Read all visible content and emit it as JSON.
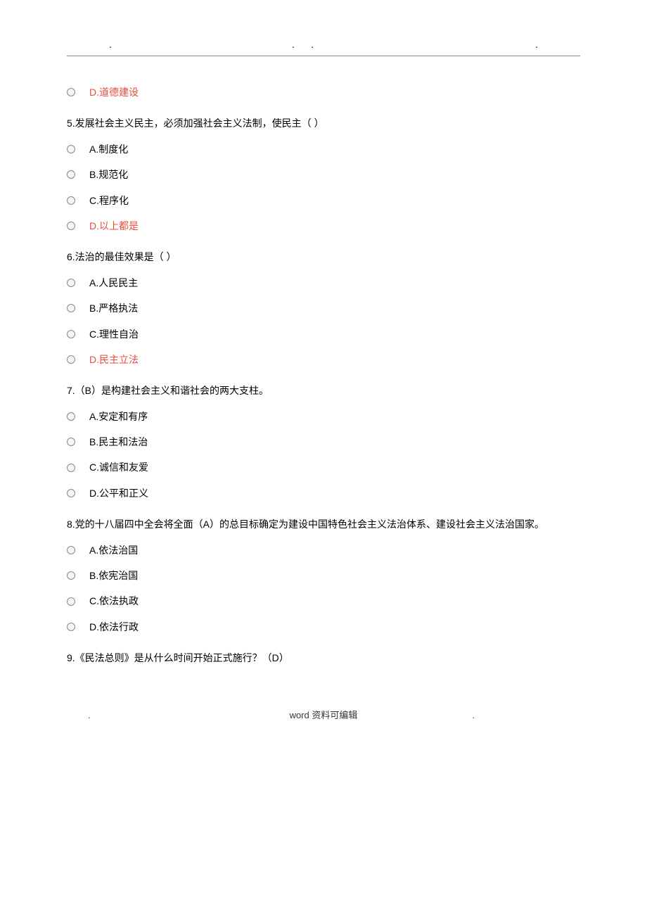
{
  "options_pre": [
    {
      "label": "D.道德建设",
      "highlighted": true
    }
  ],
  "questions": [
    {
      "text": "5.发展社会主义民主，必须加强社会主义法制，使民主（ ）",
      "options": [
        {
          "label": "A.制度化",
          "highlighted": false
        },
        {
          "label": "B.规范化",
          "highlighted": false
        },
        {
          "label": "C.程序化",
          "highlighted": false
        },
        {
          "label": "D.以上都是",
          "highlighted": true
        }
      ]
    },
    {
      "text": "6.法治的最佳效果是（ ）",
      "options": [
        {
          "label": "A.人民民主",
          "highlighted": false
        },
        {
          "label": "B.严格执法",
          "highlighted": false
        },
        {
          "label": "C.理性自治",
          "highlighted": false
        },
        {
          "label": "D.民主立法",
          "highlighted": true
        }
      ]
    },
    {
      "text": "7.（B）是构建社会主义和谐社会的两大支柱。",
      "options": [
        {
          "label": "A.安定和有序",
          "highlighted": false
        },
        {
          "label": "B.民主和法治",
          "highlighted": false
        },
        {
          "label": "C.诚信和友爱",
          "highlighted": false
        },
        {
          "label": "D.公平和正义",
          "highlighted": false
        }
      ]
    },
    {
      "text": "8.党的十八届四中全会将全面（A）的总目标确定为建设中国特色社会主义法治体系、建设社会主义法治国家。",
      "options": [
        {
          "label": "A.依法治国",
          "highlighted": false
        },
        {
          "label": "B.依宪治国",
          "highlighted": false
        },
        {
          "label": "C.依法执政",
          "highlighted": false
        },
        {
          "label": "D.依法行政",
          "highlighted": false
        }
      ]
    },
    {
      "text": "9.《民法总则》是从什么时间开始正式施行？（D）",
      "options": []
    }
  ],
  "footer": "word 资料可编辑"
}
